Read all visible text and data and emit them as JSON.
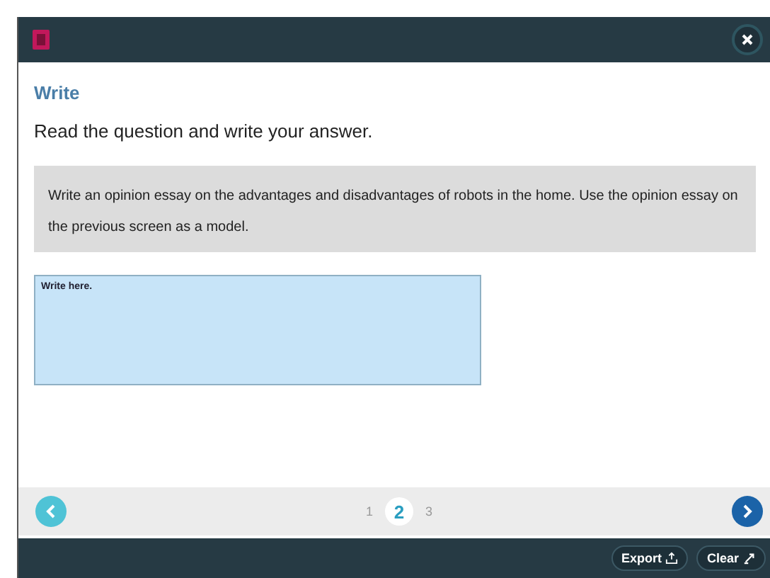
{
  "activity": {
    "title": "Write",
    "instruction": "Read the question and write your answer."
  },
  "question": "Write an opinion essay on the advantages and disadvantages of robots in the home. Use the opinion essay on the previous screen as a model.",
  "answer": {
    "placeholder": "Write here."
  },
  "navigation": {
    "previous": {
      "disabled": true
    },
    "next": {
      "disabled": false
    },
    "pages": [
      {
        "label": "1",
        "selected": false
      },
      {
        "label": "2",
        "selected": true
      },
      {
        "label": "3",
        "selected": false
      }
    ]
  },
  "footer_buttons": [
    {
      "label": "Export",
      "kind": "export"
    },
    {
      "label": "Clear",
      "kind": "clear"
    }
  ]
}
